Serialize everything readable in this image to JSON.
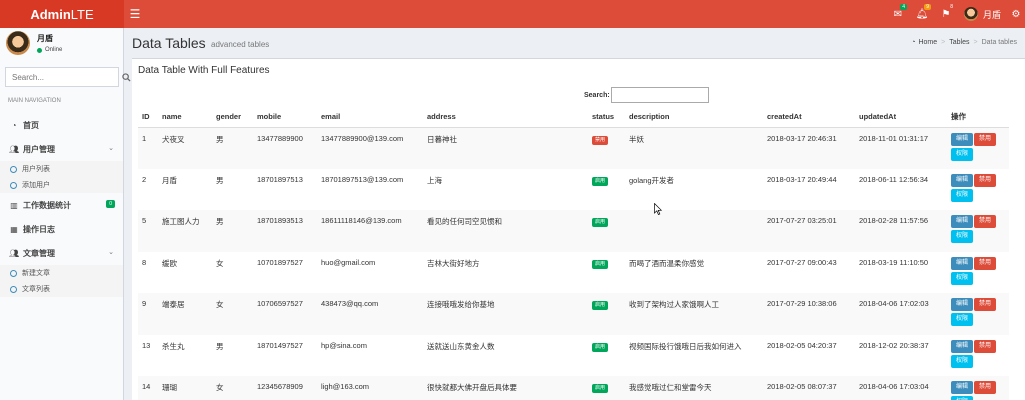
{
  "header": {
    "logo_bold": "Admin",
    "logo_light": "LTE",
    "toggle_icon": "bars-icon",
    "badges": {
      "messages": "4",
      "notifications": "9",
      "tasks": "8"
    },
    "user_name": "月盾"
  },
  "sidebar": {
    "user_name": "月盾",
    "user_status": "Online",
    "search_placeholder": "Search...",
    "nav_header": "MAIN NAVIGATION",
    "items": [
      {
        "label": "首页",
        "icon": "dashboard-icon"
      },
      {
        "label": "用户管理",
        "icon": "users-icon",
        "children": [
          "用户列表",
          "添加用户"
        ]
      },
      {
        "label": "工作数据统计",
        "icon": "bar-chart-icon",
        "count": "0"
      },
      {
        "label": "操作日志",
        "icon": "table-icon"
      },
      {
        "label": "文章管理",
        "icon": "users-icon",
        "children": [
          "新建文章",
          "文章列表"
        ]
      }
    ]
  },
  "content": {
    "title": "Data Tables",
    "subtitle": "advanced tables",
    "breadcrumb": {
      "home": "Home",
      "tables": "Tables",
      "current": "Data tables"
    },
    "box_title": "Data Table With Full Features",
    "search_label": "Search:",
    "search_value": ""
  },
  "table": {
    "columns": [
      "ID",
      "name",
      "gender",
      "mobile",
      "email",
      "address",
      "status",
      "description",
      "createdAt",
      "updatedAt",
      "操作"
    ],
    "actions": {
      "edit": "编辑",
      "ban": "禁用",
      "perm": "权限"
    },
    "rows": [
      {
        "id": "1",
        "name": "犬夜叉",
        "gender": "男",
        "mobile": "13477889900",
        "email": "13477889900@139.com",
        "address": "日暮神社",
        "status": "禁用",
        "status_type": "disabled",
        "description": "半妖",
        "createdAt": "2018-03-17 20:46:31",
        "updatedAt": "2018-11-01 01:31:17"
      },
      {
        "id": "2",
        "name": "月盾",
        "gender": "男",
        "mobile": "18701897513",
        "email": "18701897513@139.com",
        "address": "上海",
        "status": "启用",
        "status_type": "enabled",
        "description": "golang开发者",
        "createdAt": "2018-03-17 20:49:44",
        "updatedAt": "2018-06-11 12:56:34"
      },
      {
        "id": "5",
        "name": "施工图人力",
        "gender": "男",
        "mobile": "18701893513",
        "email": "18611118146@139.com",
        "address": "看见的任何司空见惯和",
        "status": "启用",
        "status_type": "enabled",
        "description": "",
        "createdAt": "2017-07-27 03:25:01",
        "updatedAt": "2018-02-28 11:57:56"
      },
      {
        "id": "8",
        "name": "缓欧",
        "gender": "女",
        "mobile": "10701897527",
        "email": "huo@gmail.com",
        "address": "吉林大街好地方",
        "status": "启用",
        "status_type": "enabled",
        "description": "而喝了酒而温柔你感觉",
        "createdAt": "2017-07-27 09:00:43",
        "updatedAt": "2018-03-19 11:10:50"
      },
      {
        "id": "9",
        "name": "端泰居",
        "gender": "女",
        "mobile": "10706597527",
        "email": "438473@qq.com",
        "address": "连接哦哦发给你基地",
        "status": "启用",
        "status_type": "enabled",
        "description": "收到了架构过人家饿啊人工",
        "createdAt": "2017-07-29 10:38:06",
        "updatedAt": "2018-04-06 17:02:03"
      },
      {
        "id": "13",
        "name": "杀生丸",
        "gender": "男",
        "mobile": "18701497527",
        "email": "hp@sina.com",
        "address": "送就送山东黄金人数",
        "status": "启用",
        "status_type": "enabled",
        "description": "视频国际投行饿哦日后我如何进入",
        "createdAt": "2018-02-05 04:20:37",
        "updatedAt": "2018-12-02 20:38:37"
      },
      {
        "id": "14",
        "name": "珊瑚",
        "gender": "女",
        "mobile": "12345678909",
        "email": "ligh@163.com",
        "address": "很快就都大佛开盘后具体要",
        "status": "启用",
        "status_type": "enabled",
        "description": "我感觉哦过仁和堂雷今天",
        "createdAt": "2018-02-05 08:07:37",
        "updatedAt": "2018-04-06 17:03:04"
      }
    ]
  }
}
